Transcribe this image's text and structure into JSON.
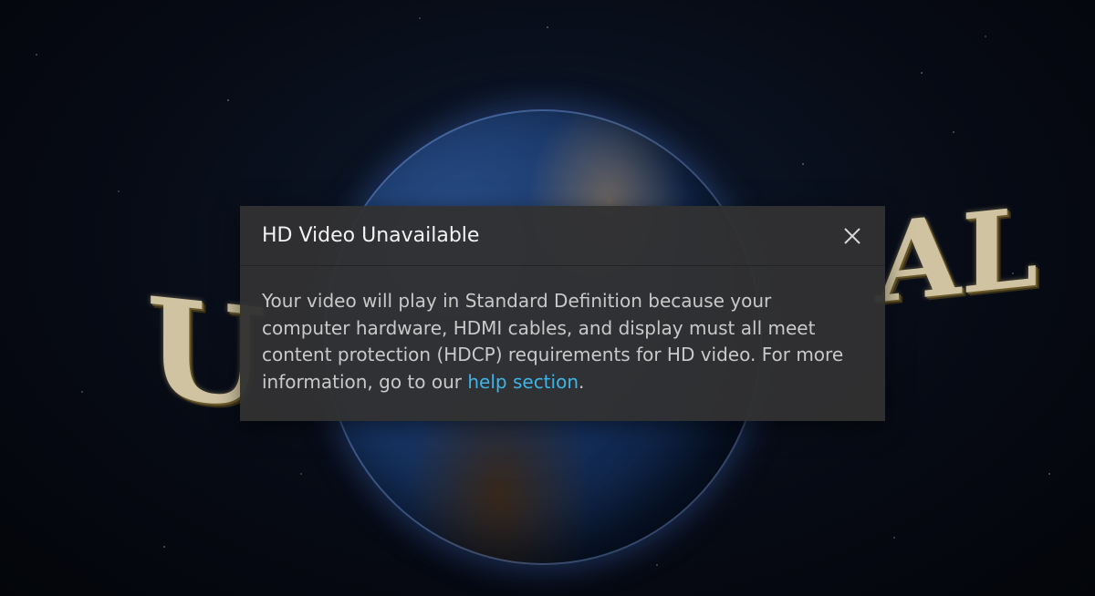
{
  "dialog": {
    "title": "HD Video Unavailable",
    "close_icon": "close-icon",
    "body_text": "Your video will play in Standard Definition because your computer hardware, HDMI cables, and display must all meet content protection (HDCP) requirements for HD video. For more information, go to our ",
    "link_text": "help section",
    "body_end": ".",
    "link_color": "#3fb4e6"
  },
  "background": {
    "letter_left": "U",
    "letter_right": "AL"
  }
}
